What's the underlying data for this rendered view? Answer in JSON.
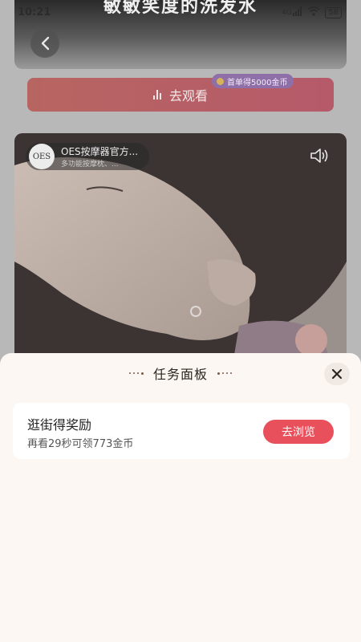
{
  "status_bar": {
    "time": "10:21",
    "signal": "4G",
    "battery": "58"
  },
  "feed": {
    "top_caption": "敏敏笑度的洗发水",
    "watch_button_label": "去观看",
    "first_order_badge": "首单得5000金币",
    "ad": {
      "brand_logo_text": "OES",
      "brand_name": "OES按摩器官方...",
      "brand_sub": "多功能按摩枕、..."
    }
  },
  "task_panel": {
    "title": "任务面板",
    "tasks": [
      {
        "title": "逛街得奖励",
        "desc": "再看29秒可领773金币",
        "button_label": "去浏览"
      }
    ]
  },
  "colors": {
    "accent": "#e8505c",
    "sheet_bg": "#fcf7f2",
    "badge_purple": "#8e6fa8"
  },
  "icons": [
    "chevron-left-icon",
    "volume-icon",
    "close-icon",
    "chart-bars-icon",
    "coin-icon",
    "wifi-icon",
    "signal-icon",
    "battery-icon"
  ]
}
